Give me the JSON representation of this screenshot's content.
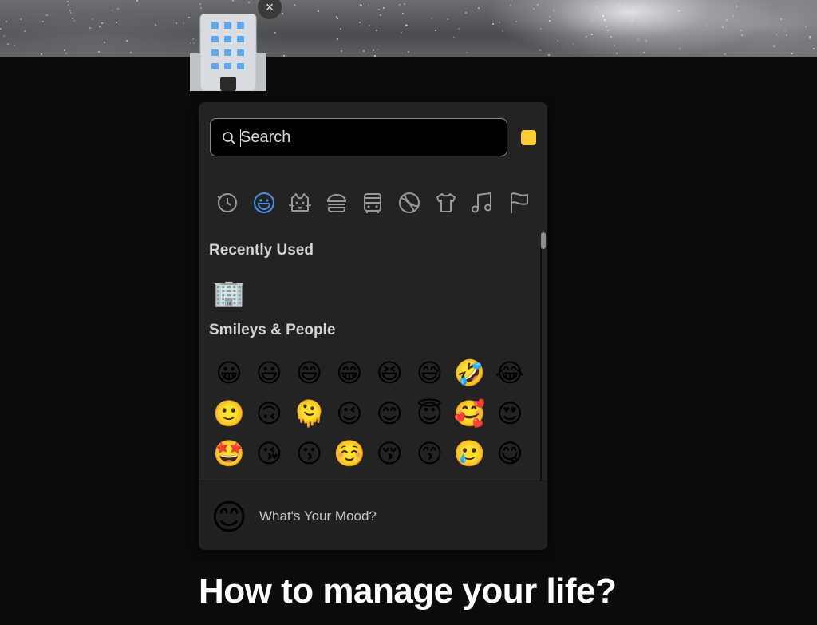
{
  "page": {
    "icon": "🏢",
    "remove_icon_label": "×",
    "title": "How to manage your life?"
  },
  "picker": {
    "search": {
      "placeholder": "Search",
      "value": ""
    },
    "skin_tone_color": "#ffcc33",
    "categories": [
      {
        "name": "recent-icon",
        "active": false
      },
      {
        "name": "smiley-icon",
        "active": true
      },
      {
        "name": "cat-icon",
        "active": false
      },
      {
        "name": "burger-icon",
        "active": false
      },
      {
        "name": "bus-icon",
        "active": false
      },
      {
        "name": "ball-icon",
        "active": false
      },
      {
        "name": "shirt-icon",
        "active": false
      },
      {
        "name": "music-icon",
        "active": false
      },
      {
        "name": "flag-icon",
        "active": false
      }
    ],
    "accent_color": "#4a90e2",
    "sections": {
      "recent": {
        "title": "Recently Used",
        "emojis": [
          "🏢"
        ]
      },
      "smileys": {
        "title": "Smileys & People",
        "rows": [
          [
            "😀",
            "😃",
            "😄",
            "😁",
            "😆",
            "😅",
            "🤣",
            "😂"
          ],
          [
            "🙂",
            "🙃",
            "🫠",
            "😉",
            "😊",
            "😇",
            "🥰",
            "😍"
          ],
          [
            "🤩",
            "😘",
            "😗",
            "☺️",
            "😚",
            "😙",
            "🥲",
            "😋"
          ],
          [
            "😛",
            "😜",
            "🤪",
            "😝",
            "🤑",
            "🤗",
            "🤭",
            "🫢"
          ]
        ]
      }
    },
    "footer": {
      "emoji": "😊",
      "label": "What's Your Mood?"
    }
  }
}
